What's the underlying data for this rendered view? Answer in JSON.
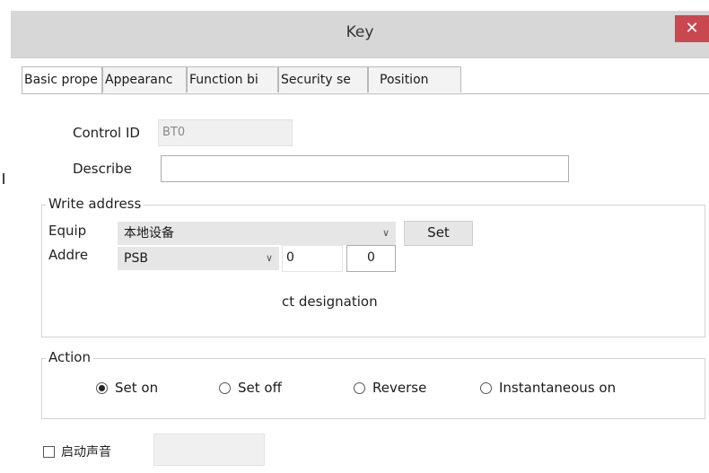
{
  "window": {
    "title": "Key",
    "close_glyph": "✕"
  },
  "tabs": [
    "Basic prope",
    "Appearanc",
    "Function bi",
    "Security se",
    "Position"
  ],
  "basic": {
    "control_id_label": "Control ID",
    "control_id_value": "BT0",
    "describe_label": "Describe",
    "describe_value": ""
  },
  "write_address": {
    "legend": "Write address",
    "equip_label": "Equip",
    "equip_value": "本地设备",
    "set_button": "Set",
    "addr_label": "Addre",
    "addr_type": "PSB",
    "addr_value": "0",
    "addr_offset": "0",
    "indirect_text": "ct designation"
  },
  "action": {
    "legend": "Action",
    "options": [
      "Set on",
      "Set off",
      "Reverse",
      "Instantaneous on"
    ],
    "selected": "Set on"
  },
  "sound": {
    "label": "启动声音",
    "value": ""
  },
  "icons": {
    "close": "close-icon",
    "dropdown": "chevron-down-icon"
  }
}
